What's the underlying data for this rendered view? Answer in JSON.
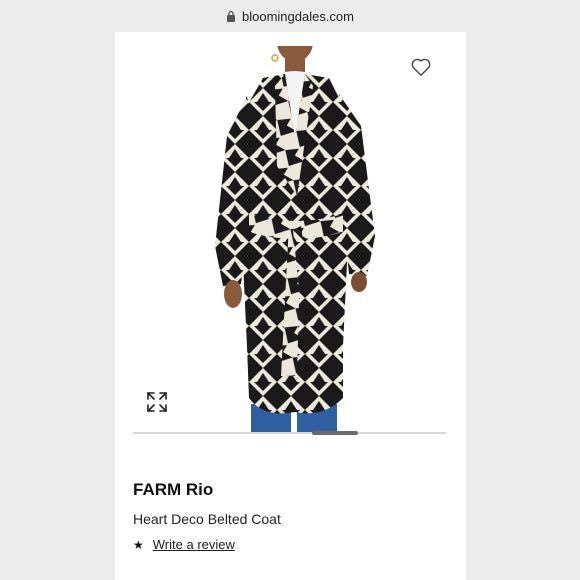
{
  "browser": {
    "url": "bloomingdales.com",
    "lock_icon": "lock-icon"
  },
  "product": {
    "brand": "FARM Rio",
    "name": "Heart Deco Belted Coat",
    "review_link": "Write a review",
    "rating_icon": "star-icon",
    "favorite_icon": "heart-icon",
    "expand_icon": "expand-icon"
  },
  "colors": {
    "coat_black": "#1a1a1a",
    "coat_cream": "#ece8dc",
    "jeans": "#2f5fa0"
  }
}
